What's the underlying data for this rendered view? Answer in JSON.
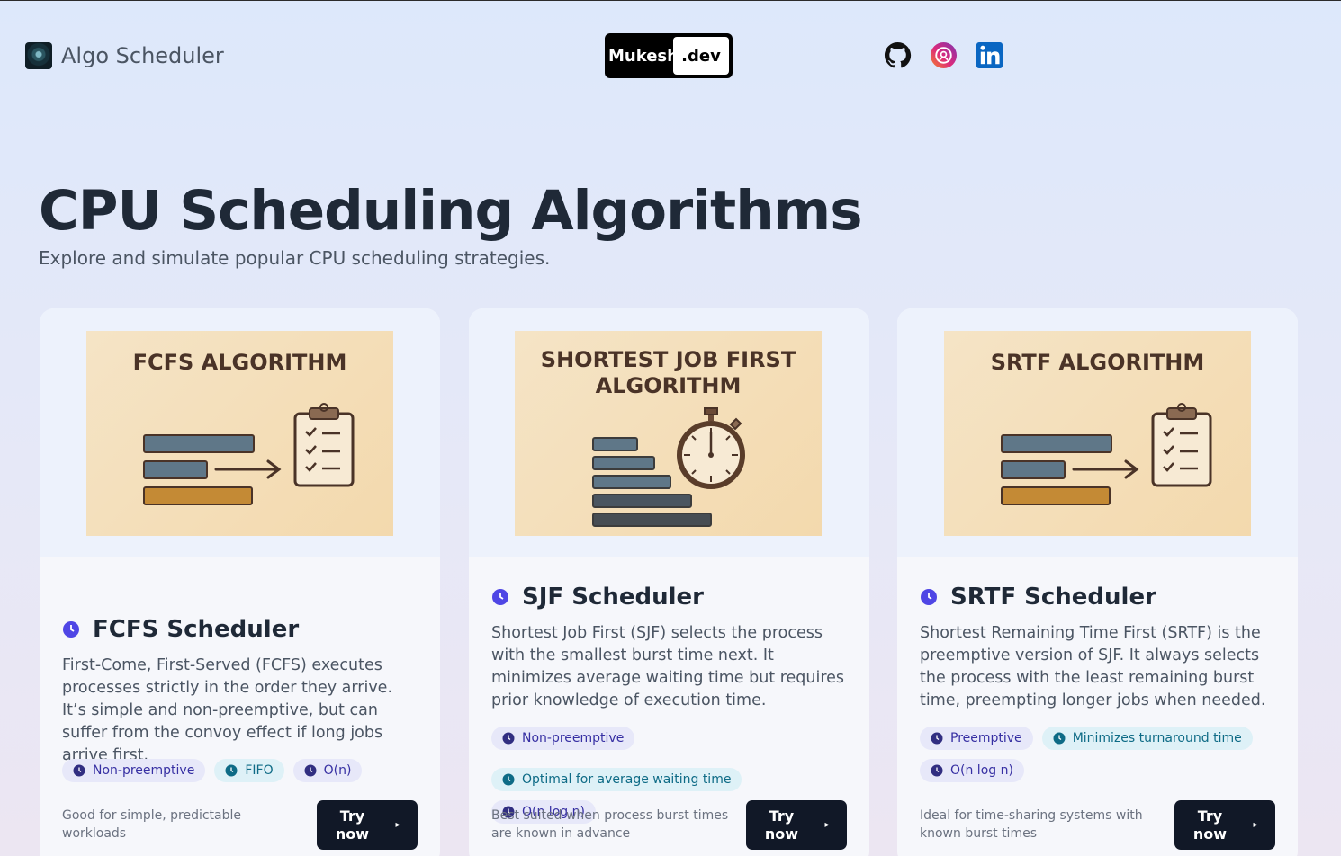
{
  "header": {
    "brand_name": "Algo Scheduler",
    "badge_left": "Mukesh",
    "badge_right": ".dev",
    "socials": [
      "github-icon",
      "instagram-icon",
      "linkedin-icon"
    ]
  },
  "hero": {
    "title": "CPU Scheduling Algorithms",
    "subtitle": "Explore and simulate popular CPU scheduling strategies."
  },
  "colors": {
    "accent": "#4f46e5",
    "button": "#111827",
    "tag_indigo_bg": "#e7e8f9",
    "tag_cyan_bg": "#def1f7"
  },
  "cards": [
    {
      "thumb_title": "FCFS ALGORITHM",
      "title": "FCFS Scheduler",
      "description": "First-Come, First-Served (FCFS) executes processes strictly in the order they arrive. It’s simple and non-preemptive, but can suffer from the convoy effect if long jobs arrive first.",
      "tags": [
        {
          "label": "Non-preemptive",
          "color": "indigo"
        },
        {
          "label": "FIFO",
          "color": "cyan"
        },
        {
          "label": "O(n)",
          "color": "indigo"
        }
      ],
      "footer": "Good for simple, predictable workloads",
      "button": "Try now"
    },
    {
      "thumb_title": "SHORTEST JOB FIRST ALGORITHM",
      "title": "SJF Scheduler",
      "description": "Shortest Job First (SJF) selects the process with the smallest burst time next. It minimizes average waiting time but requires prior knowledge of execution time.",
      "tags": [
        {
          "label": "Non-preemptive",
          "color": "indigo"
        },
        {
          "label": "Optimal for average waiting time",
          "color": "cyan"
        },
        {
          "label": "O(n log n)",
          "color": "indigo"
        }
      ],
      "footer": "Best suited when process burst times are known in advance",
      "button": "Try now"
    },
    {
      "thumb_title": "SRTF ALGORITHM",
      "title": "SRTF Scheduler",
      "description": "Shortest Remaining Time First (SRTF) is the preemptive version of SJF. It always selects the process with the least remaining burst time, preempting longer jobs when needed.",
      "tags": [
        {
          "label": "Preemptive",
          "color": "indigo"
        },
        {
          "label": "Minimizes turnaround time",
          "color": "cyan"
        },
        {
          "label": "O(n log n)",
          "color": "indigo"
        }
      ],
      "footer": "Ideal for time-sharing systems with known burst times",
      "button": "Try now"
    }
  ]
}
